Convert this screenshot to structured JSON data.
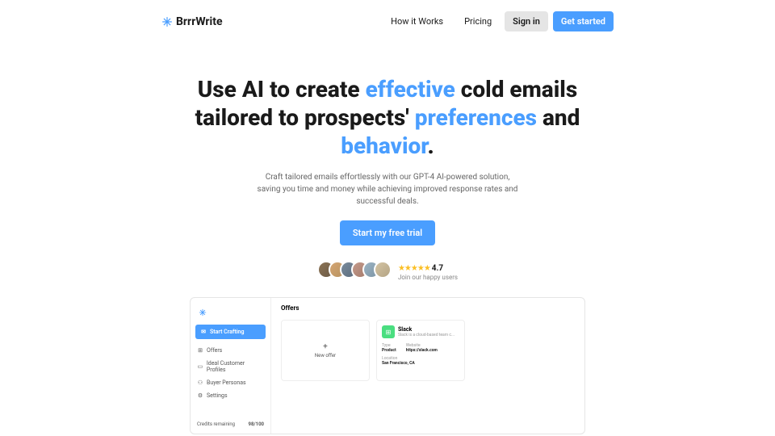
{
  "brand": "BrrrWrite",
  "nav": {
    "how": "How it Works",
    "pricing": "Pricing",
    "signin": "Sign in",
    "cta": "Get started"
  },
  "hero": {
    "h1_1": "Use AI to create ",
    "hl1": "effective",
    "h1_2": " cold emails tailored to prospects' ",
    "hl2": "preferences",
    "h1_3": " and ",
    "hl3": "behavior",
    "h1_4": ".",
    "sub": "Craft tailored emails effortlessly with our GPT-4 AI-powered solution, saving you time and money while achieving improved response rates and successful deals.",
    "trial": "Start my free trial",
    "stars": "★★★★★",
    "score": "4.7",
    "join": "Join our happy users"
  },
  "app": {
    "sidebar": {
      "start": "Start Crafting",
      "items": [
        "Offers",
        "Ideal Customer Profiles",
        "Buyer Personas",
        "Settings"
      ],
      "credits_label": "Credits remaining",
      "credits_value": "98/100"
    },
    "main": {
      "title": "Offers",
      "new": "New offer",
      "offer": {
        "name": "Slack",
        "desc": "Slack is a cloud-based team c...",
        "type_l": "Type",
        "type_v": "Product",
        "site_l": "Website",
        "site_v": "https://slack.com",
        "loc_l": "Location",
        "loc_v": "San Francisco, CA"
      }
    }
  }
}
